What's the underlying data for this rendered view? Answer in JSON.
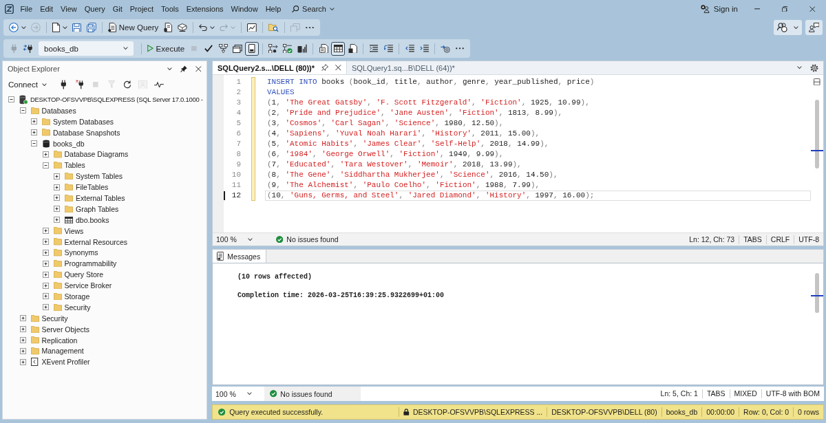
{
  "title_bar": {
    "menu": [
      "File",
      "Edit",
      "View",
      "Query",
      "Git",
      "Project",
      "Tools",
      "Extensions",
      "Window",
      "Help"
    ],
    "search": "Search",
    "sign_in": "Sign in"
  },
  "standard_toolbar": {
    "groups": [
      [
        {
          "kind": "back",
          "menu": true,
          "disabled": false
        },
        {
          "kind": "forward",
          "menu": false,
          "disabled": true
        }
      ],
      [
        {
          "kind": "new-file",
          "menu": true,
          "disabled": false
        },
        {
          "kind": "save",
          "menu": false,
          "disabled": false
        },
        {
          "kind": "save-all",
          "menu": false,
          "disabled": false
        }
      ],
      [
        {
          "kind": "new-query",
          "label": "New Query",
          "menu": false,
          "disabled": false
        },
        {
          "kind": "engine-query",
          "menu": false,
          "disabled": false
        },
        {
          "kind": "dax-query",
          "menu": false,
          "disabled": false
        }
      ],
      [
        {
          "kind": "undo",
          "menu": true,
          "disabled": false
        },
        {
          "kind": "redo",
          "menu": true,
          "disabled": true
        }
      ],
      [
        {
          "kind": "activity",
          "menu": false,
          "disabled": false
        }
      ],
      [
        {
          "kind": "find-folder",
          "menu": false,
          "disabled": false
        }
      ],
      [
        {
          "kind": "copy-window",
          "menu": false,
          "disabled": true
        },
        {
          "kind": "more",
          "menu": false,
          "disabled": false
        }
      ]
    ],
    "right": [
      {
        "kind": "assistant",
        "menu": true
      },
      {
        "kind": "feedback",
        "menu": false
      }
    ]
  },
  "sql_toolbar": {
    "lead": [
      {
        "kind": "plug",
        "disabled": true
      },
      {
        "kind": "change-connection",
        "disabled": false
      }
    ],
    "database": "books_db",
    "groups": [
      [
        {
          "kind": "execute",
          "label": "Execute",
          "disabled": false,
          "pressed": false
        },
        {
          "kind": "stop",
          "disabled": true,
          "pressed": false
        },
        {
          "kind": "parse",
          "disabled": false,
          "pressed": false
        },
        {
          "kind": "plan",
          "disabled": false,
          "pressed": false
        },
        {
          "kind": "query-window",
          "disabled": false,
          "pressed": false
        },
        {
          "kind": "design",
          "disabled": false,
          "pressed": true
        }
      ],
      [
        {
          "kind": "actual-plan",
          "disabled": false,
          "pressed": false
        },
        {
          "kind": "live-stats",
          "disabled": false,
          "pressed": false
        },
        {
          "kind": "client-stats",
          "disabled": false,
          "pressed": false
        }
      ],
      [
        {
          "kind": "to-text",
          "disabled": false,
          "pressed": false
        },
        {
          "kind": "to-grid",
          "disabled": false,
          "pressed": true
        },
        {
          "kind": "to-file",
          "disabled": false,
          "pressed": false
        }
      ],
      [
        {
          "kind": "comment",
          "disabled": false,
          "pressed": false
        },
        {
          "kind": "uncomment",
          "disabled": false,
          "pressed": false
        }
      ],
      [
        {
          "kind": "outdent",
          "disabled": false,
          "pressed": false
        },
        {
          "kind": "indent",
          "disabled": false,
          "pressed": false
        }
      ],
      [
        {
          "kind": "template",
          "disabled": false,
          "pressed": false
        },
        {
          "kind": "more",
          "disabled": false,
          "pressed": false
        }
      ]
    ]
  },
  "object_explorer": {
    "title": "Object Explorer",
    "connect": "Connect",
    "tools": [
      {
        "kind": "connect",
        "disabled": false
      },
      {
        "kind": "disconnect",
        "disabled": false
      },
      {
        "kind": "stop",
        "disabled": true
      },
      {
        "kind": "filter",
        "disabled": true
      },
      {
        "kind": "refresh",
        "disabled": false
      },
      {
        "kind": "monitor",
        "disabled": true
      },
      {
        "kind": "pulse",
        "disabled": false
      }
    ],
    "tree": [
      {
        "label": "DESKTOP-OFSVVPB\\SQLEXPRESS (SQL Server 17.0.1000 -",
        "kind": "server",
        "expanded": true,
        "children": [
          {
            "label": "Databases",
            "kind": "folder",
            "expanded": true,
            "children": [
              {
                "label": "System Databases",
                "kind": "folder",
                "expanded": false
              },
              {
                "label": "Database Snapshots",
                "kind": "folder",
                "expanded": false
              },
              {
                "label": "books_db",
                "kind": "database",
                "expanded": true,
                "children": [
                  {
                    "label": "Database Diagrams",
                    "kind": "folder",
                    "expanded": false
                  },
                  {
                    "label": "Tables",
                    "kind": "folder",
                    "expanded": true,
                    "children": [
                      {
                        "label": "System Tables",
                        "kind": "folder",
                        "expanded": false
                      },
                      {
                        "label": "FileTables",
                        "kind": "folder",
                        "expanded": false
                      },
                      {
                        "label": "External Tables",
                        "kind": "folder",
                        "expanded": false
                      },
                      {
                        "label": "Graph Tables",
                        "kind": "folder",
                        "expanded": false
                      },
                      {
                        "label": "dbo.books",
                        "kind": "table",
                        "expanded": false
                      }
                    ]
                  },
                  {
                    "label": "Views",
                    "kind": "folder",
                    "expanded": false
                  },
                  {
                    "label": "External Resources",
                    "kind": "folder",
                    "expanded": false
                  },
                  {
                    "label": "Synonyms",
                    "kind": "folder",
                    "expanded": false
                  },
                  {
                    "label": "Programmability",
                    "kind": "folder",
                    "expanded": false
                  },
                  {
                    "label": "Query Store",
                    "kind": "folder",
                    "expanded": false
                  },
                  {
                    "label": "Service Broker",
                    "kind": "folder",
                    "expanded": false
                  },
                  {
                    "label": "Storage",
                    "kind": "folder",
                    "expanded": false
                  },
                  {
                    "label": "Security",
                    "kind": "folder",
                    "expanded": false
                  }
                ]
              }
            ]
          },
          {
            "label": "Security",
            "kind": "folder",
            "expanded": false
          },
          {
            "label": "Server Objects",
            "kind": "folder",
            "expanded": false
          },
          {
            "label": "Replication",
            "kind": "folder",
            "expanded": false
          },
          {
            "label": "Management",
            "kind": "folder",
            "expanded": false
          },
          {
            "label": "XEvent Profiler",
            "kind": "profiler",
            "expanded": false
          }
        ]
      }
    ]
  },
  "editor": {
    "tabs": [
      {
        "label": "SQLQuery2.s...\\DELL (80))*",
        "selected": true
      },
      {
        "label": "SQLQuery1.sq...B\\DELL (64))*",
        "selected": false
      }
    ],
    "modified": true,
    "lines": [
      {
        "number": "1",
        "current": false,
        "tokens": [
          {
            "kind": "keyword",
            "text": "INSERT INTO"
          },
          {
            "kind": "plain",
            "text": " books "
          },
          {
            "kind": "punct",
            "text": "("
          },
          {
            "kind": "plain",
            "text": "book_id"
          },
          {
            "kind": "punct",
            "text": ", "
          },
          {
            "kind": "plain",
            "text": "title"
          },
          {
            "kind": "punct",
            "text": ", "
          },
          {
            "kind": "plain",
            "text": "author"
          },
          {
            "kind": "punct",
            "text": ", "
          },
          {
            "kind": "plain",
            "text": "genre"
          },
          {
            "kind": "punct",
            "text": ", "
          },
          {
            "kind": "plain",
            "text": "year_published"
          },
          {
            "kind": "punct",
            "text": ", "
          },
          {
            "kind": "plain",
            "text": "price"
          },
          {
            "kind": "punct",
            "text": ")"
          }
        ]
      },
      {
        "number": "2",
        "current": false,
        "tokens": [
          {
            "kind": "keyword",
            "text": "VALUES"
          }
        ]
      },
      {
        "number": "3",
        "current": false,
        "tokens": [
          {
            "kind": "punct",
            "text": "("
          },
          {
            "kind": "number",
            "text": "1"
          },
          {
            "kind": "punct",
            "text": ", "
          },
          {
            "kind": "string",
            "text": "'The Great Gatsby'"
          },
          {
            "kind": "punct",
            "text": ", "
          },
          {
            "kind": "string",
            "text": "'F. Scott Fitzgerald'"
          },
          {
            "kind": "punct",
            "text": ", "
          },
          {
            "kind": "string",
            "text": "'Fiction'"
          },
          {
            "kind": "punct",
            "text": ", "
          },
          {
            "kind": "number",
            "text": "1925"
          },
          {
            "kind": "punct",
            "text": ", "
          },
          {
            "kind": "number",
            "text": "10.99"
          },
          {
            "kind": "punct",
            "text": "),"
          }
        ]
      },
      {
        "number": "4",
        "current": false,
        "tokens": [
          {
            "kind": "punct",
            "text": "("
          },
          {
            "kind": "number",
            "text": "2"
          },
          {
            "kind": "punct",
            "text": ", "
          },
          {
            "kind": "string",
            "text": "'Pride and Prejudice'"
          },
          {
            "kind": "punct",
            "text": ", "
          },
          {
            "kind": "string",
            "text": "'Jane Austen'"
          },
          {
            "kind": "punct",
            "text": ", "
          },
          {
            "kind": "string",
            "text": "'Fiction'"
          },
          {
            "kind": "punct",
            "text": ", "
          },
          {
            "kind": "number",
            "text": "1813"
          },
          {
            "kind": "punct",
            "text": ", "
          },
          {
            "kind": "number",
            "text": "8.99"
          },
          {
            "kind": "punct",
            "text": "),"
          }
        ]
      },
      {
        "number": "5",
        "current": false,
        "tokens": [
          {
            "kind": "punct",
            "text": "("
          },
          {
            "kind": "number",
            "text": "3"
          },
          {
            "kind": "punct",
            "text": ", "
          },
          {
            "kind": "string",
            "text": "'Cosmos'"
          },
          {
            "kind": "punct",
            "text": ", "
          },
          {
            "kind": "string",
            "text": "'Carl Sagan'"
          },
          {
            "kind": "punct",
            "text": ", "
          },
          {
            "kind": "string",
            "text": "'Science'"
          },
          {
            "kind": "punct",
            "text": ", "
          },
          {
            "kind": "number",
            "text": "1980"
          },
          {
            "kind": "punct",
            "text": ", "
          },
          {
            "kind": "number",
            "text": "12.50"
          },
          {
            "kind": "punct",
            "text": "),"
          }
        ]
      },
      {
        "number": "6",
        "current": false,
        "tokens": [
          {
            "kind": "punct",
            "text": "("
          },
          {
            "kind": "number",
            "text": "4"
          },
          {
            "kind": "punct",
            "text": ", "
          },
          {
            "kind": "string",
            "text": "'Sapiens'"
          },
          {
            "kind": "punct",
            "text": ", "
          },
          {
            "kind": "string",
            "text": "'Yuval Noah Harari'"
          },
          {
            "kind": "punct",
            "text": ", "
          },
          {
            "kind": "string",
            "text": "'History'"
          },
          {
            "kind": "punct",
            "text": ", "
          },
          {
            "kind": "number",
            "text": "2011"
          },
          {
            "kind": "punct",
            "text": ", "
          },
          {
            "kind": "number",
            "text": "15.00"
          },
          {
            "kind": "punct",
            "text": "),"
          }
        ]
      },
      {
        "number": "7",
        "current": false,
        "tokens": [
          {
            "kind": "punct",
            "text": "("
          },
          {
            "kind": "number",
            "text": "5"
          },
          {
            "kind": "punct",
            "text": ", "
          },
          {
            "kind": "string",
            "text": "'Atomic Habits'"
          },
          {
            "kind": "punct",
            "text": ", "
          },
          {
            "kind": "string",
            "text": "'James Clear'"
          },
          {
            "kind": "punct",
            "text": ", "
          },
          {
            "kind": "string",
            "text": "'Self-Help'"
          },
          {
            "kind": "punct",
            "text": ", "
          },
          {
            "kind": "number",
            "text": "2018"
          },
          {
            "kind": "punct",
            "text": ", "
          },
          {
            "kind": "number",
            "text": "14.99"
          },
          {
            "kind": "punct",
            "text": "),"
          }
        ]
      },
      {
        "number": "8",
        "current": false,
        "tokens": [
          {
            "kind": "punct",
            "text": "("
          },
          {
            "kind": "number",
            "text": "6"
          },
          {
            "kind": "punct",
            "text": ", "
          },
          {
            "kind": "string",
            "text": "'1984'"
          },
          {
            "kind": "punct",
            "text": ", "
          },
          {
            "kind": "string",
            "text": "'George Orwell'"
          },
          {
            "kind": "punct",
            "text": ", "
          },
          {
            "kind": "string",
            "text": "'Fiction'"
          },
          {
            "kind": "punct",
            "text": ", "
          },
          {
            "kind": "number",
            "text": "1949"
          },
          {
            "kind": "punct",
            "text": ", "
          },
          {
            "kind": "number",
            "text": "9.99"
          },
          {
            "kind": "punct",
            "text": "),"
          }
        ]
      },
      {
        "number": "9",
        "current": false,
        "tokens": [
          {
            "kind": "punct",
            "text": "("
          },
          {
            "kind": "number",
            "text": "7"
          },
          {
            "kind": "punct",
            "text": ", "
          },
          {
            "kind": "string",
            "text": "'Educated'"
          },
          {
            "kind": "punct",
            "text": ", "
          },
          {
            "kind": "string",
            "text": "'Tara Westover'"
          },
          {
            "kind": "punct",
            "text": ", "
          },
          {
            "kind": "string",
            "text": "'Memoir'"
          },
          {
            "kind": "punct",
            "text": ", "
          },
          {
            "kind": "number",
            "text": "2018"
          },
          {
            "kind": "punct",
            "text": ", "
          },
          {
            "kind": "number",
            "text": "13.99"
          },
          {
            "kind": "punct",
            "text": "),"
          }
        ]
      },
      {
        "number": "10",
        "current": false,
        "tokens": [
          {
            "kind": "punct",
            "text": "("
          },
          {
            "kind": "number",
            "text": "8"
          },
          {
            "kind": "punct",
            "text": ", "
          },
          {
            "kind": "string",
            "text": "'The Gene'"
          },
          {
            "kind": "punct",
            "text": ", "
          },
          {
            "kind": "string",
            "text": "'Siddhartha Mukherjee'"
          },
          {
            "kind": "punct",
            "text": ", "
          },
          {
            "kind": "string",
            "text": "'Science'"
          },
          {
            "kind": "punct",
            "text": ", "
          },
          {
            "kind": "number",
            "text": "2016"
          },
          {
            "kind": "punct",
            "text": ", "
          },
          {
            "kind": "number",
            "text": "14.50"
          },
          {
            "kind": "punct",
            "text": "),"
          }
        ]
      },
      {
        "number": "11",
        "current": false,
        "tokens": [
          {
            "kind": "punct",
            "text": "("
          },
          {
            "kind": "number",
            "text": "9"
          },
          {
            "kind": "punct",
            "text": ", "
          },
          {
            "kind": "string",
            "text": "'The Alchemist'"
          },
          {
            "kind": "punct",
            "text": ", "
          },
          {
            "kind": "string",
            "text": "'Paulo Coelho'"
          },
          {
            "kind": "punct",
            "text": ", "
          },
          {
            "kind": "string",
            "text": "'Fiction'"
          },
          {
            "kind": "punct",
            "text": ", "
          },
          {
            "kind": "number",
            "text": "1988"
          },
          {
            "kind": "punct",
            "text": ", "
          },
          {
            "kind": "number",
            "text": "7.99"
          },
          {
            "kind": "punct",
            "text": "),"
          }
        ]
      },
      {
        "number": "12",
        "current": true,
        "tokens": [
          {
            "kind": "punct",
            "text": "("
          },
          {
            "kind": "number",
            "text": "10"
          },
          {
            "kind": "punct",
            "text": ", "
          },
          {
            "kind": "string",
            "text": "'Guns, Germs, and Steel'"
          },
          {
            "kind": "punct",
            "text": ", "
          },
          {
            "kind": "string",
            "text": "'Jared Diamond'"
          },
          {
            "kind": "punct",
            "text": ", "
          },
          {
            "kind": "string",
            "text": "'History'"
          },
          {
            "kind": "punct",
            "text": ", "
          },
          {
            "kind": "number",
            "text": "1997"
          },
          {
            "kind": "punct",
            "text": ", "
          },
          {
            "kind": "number",
            "text": "16.00"
          },
          {
            "kind": "punct",
            "text": ");"
          }
        ]
      }
    ],
    "status": {
      "zoom": "100 %",
      "issues": "No issues found",
      "position": "Ln: 12, Ch: 73",
      "indent": "TABS",
      "line_endings": "CRLF",
      "encoding": "UTF-8"
    }
  },
  "results": {
    "tab": "Messages",
    "messages": [
      "(10 rows affected)",
      "Completion time: 2026-03-25T16:39:25.9322699+01:00"
    ],
    "status": {
      "zoom": "100 %",
      "issues": "No issues found",
      "position": "Ln: 5, Ch: 1",
      "indent": "TABS",
      "line_endings": "MIXED",
      "encoding": "UTF-8 with BOM"
    }
  },
  "status_bar": {
    "message": "Query executed successfully.",
    "server": "DESKTOP-OFSVVPB\\SQLEXPRESS ...",
    "login": "DESKTOP-OFSVVPB\\DELL (80)",
    "database": "books_db",
    "elapsed": "00:00:00",
    "position": "Row: 0, Col: 0",
    "rows": "0 rows"
  }
}
